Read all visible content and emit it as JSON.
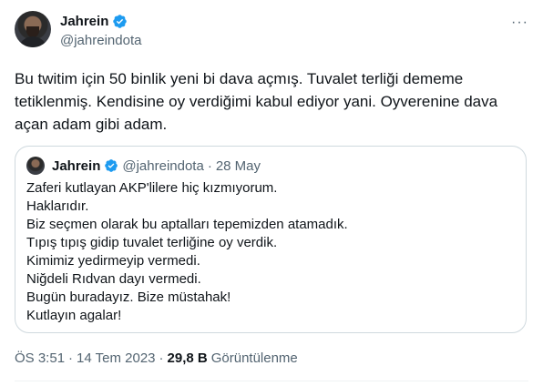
{
  "author": {
    "name": "Jahrein",
    "handle": "@jahreindota"
  },
  "more_label": "···",
  "tweet_text": "Bu twitim için 50 binlik yeni bi dava açmış. Tuvalet terliği dememe tetiklenmiş. Kendisine oy verdiğimi kabul ediyor yani. Oyverenine dava açan adam gibi adam.",
  "quote": {
    "name": "Jahrein",
    "handle": "@jahreindota",
    "dot": "·",
    "date": "28 May",
    "lines": [
      "Zaferi kutlayan AKP'lilere hiç kızmıyorum.",
      "Haklarıdır.",
      "Biz seçmen olarak bu aptalları tepemizden atamadık.",
      "Tıpış tıpış gidip tuvalet terliğine oy verdik.",
      "Kimimiz yedirmeyip vermedi.",
      "Niğdeli Rıdvan dayı vermedi.",
      "Bugün buradayız. Bize müstahak!",
      "Kutlayın agalar!"
    ]
  },
  "meta": {
    "time": "ÖS 3:51",
    "dot1": "·",
    "date": "14 Tem 2023",
    "dot2": "·",
    "views_count": "29,8 B",
    "views_label": "Görüntülenme"
  },
  "colors": {
    "verified": "#1d9bf0",
    "secondary_text": "#536471",
    "border": "#cfd9de"
  }
}
